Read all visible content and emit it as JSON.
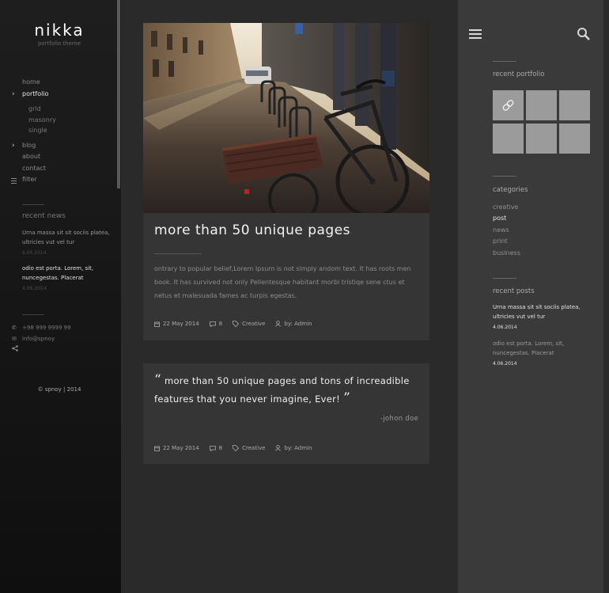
{
  "brand": {
    "logo": "nikka",
    "tagline": "portfolio theme"
  },
  "nav": {
    "home": "home",
    "portfolio": "portfolio",
    "sub": [
      "grid",
      "masonry",
      "single"
    ],
    "blog": "blog",
    "about": "about",
    "contact": "contact",
    "filter": "filter"
  },
  "left_news": {
    "heading": "recent news",
    "items": [
      {
        "text": "Urna massa sit sit sociis platea, ultricies vut vel tur",
        "date": "6.06.2014"
      },
      {
        "text": "odio est porta. Lorem, sit, nuncegestas. Placerat",
        "date": "4.06.2014"
      }
    ]
  },
  "contact": {
    "phone": "+98 999 9999 99",
    "email": "info@spnoy"
  },
  "copyright": "© spnoy | 2014",
  "posts": [
    {
      "title": "more than 50 unique pages",
      "excerpt": "ontrary to popular belief,Lorem Ipsum is not simply andom text. It has roots men  book. It has survived not only  Pellentesque habitant morbi tristiqe sene ctus et netus et malesuada fames ac turpis egestas.",
      "date": "22 May 2014",
      "comments": "8",
      "category": "Creative",
      "author": "by: Admin"
    },
    {
      "quote": "more than 50 unique  pages and tons of increadible features that  you never imagine, Ever!",
      "quote_author": "-johon doe",
      "date": "22 May 2014",
      "comments": "8",
      "category": "Creative",
      "author": "by: Admin"
    }
  ],
  "sidebar": {
    "portfolio_heading": "recent portfolio",
    "categories_heading": "categories",
    "categories": [
      "creative",
      "post",
      "news",
      "print",
      "business"
    ],
    "posts_heading": "recent posts",
    "recent_posts": [
      {
        "text": "Urna massa sit sit sociis platea, ultricies vut vel tur",
        "date": "4.06.2014"
      },
      {
        "text": "odio est porta. Lorem, sit, nuncegestas. Placerat",
        "date": "4.06.2014"
      }
    ]
  },
  "colors": {
    "tile": "#9b9b9b",
    "card": "#353535",
    "sidebar": "#3a3a3a"
  },
  "icons": [
    "chevron-right-icon",
    "filter-icon",
    "phone-icon",
    "mail-icon",
    "share-icon",
    "calendar-icon",
    "comment-icon",
    "tag-icon",
    "user-icon",
    "menu-icon",
    "search-icon",
    "link-icon"
  ]
}
